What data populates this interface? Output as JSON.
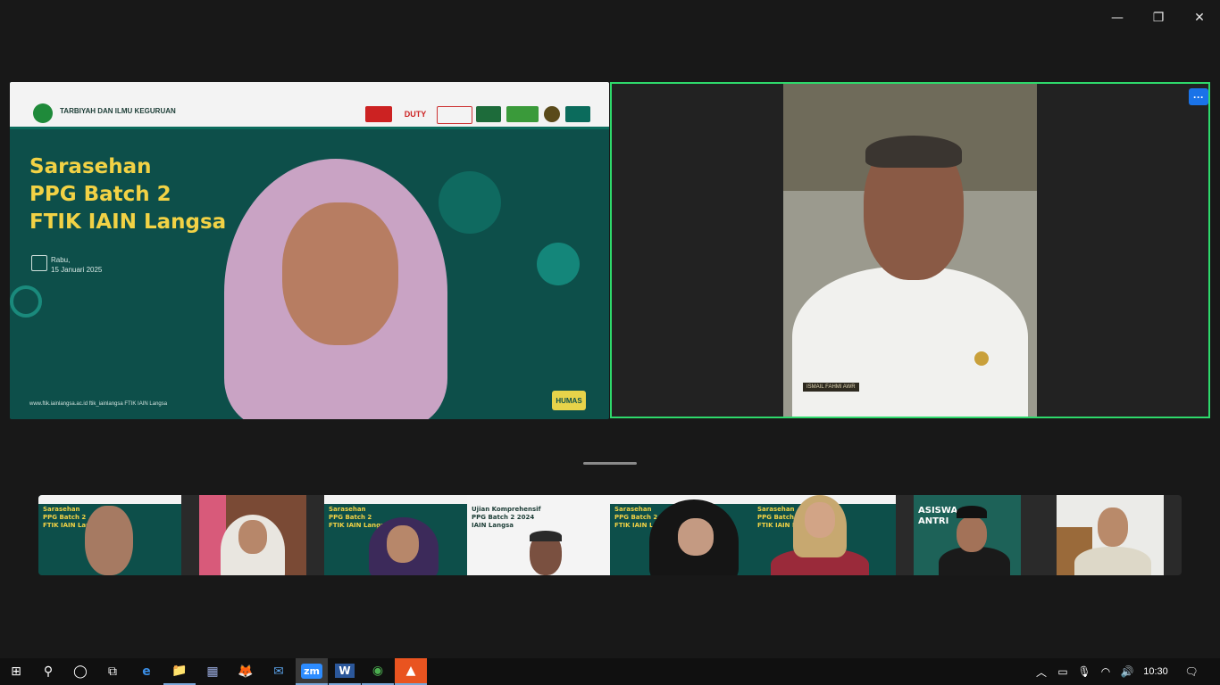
{
  "window": {
    "minimize_glyph": "—",
    "maximize_glyph": "❐",
    "close_glyph": "✕"
  },
  "main_left": {
    "institution": "TARBIYAH DAN ILMU KEGURUAN",
    "title_lines": [
      "Sarasehan",
      "PPG Batch 2",
      "FTIK IAIN Langsa"
    ],
    "date_day": "Rabu,",
    "date": "15 Januari 2025",
    "footer": "www.ftik.iainlangsa.ac.id      ftik_iainlangsa      FTIK IAIN Langsa",
    "sponsors": [
      "DUTY"
    ],
    "humas": "HUMAS"
  },
  "main_right": {
    "more_glyph": "···",
    "nametag": "ISMAIL FAHMI AWR"
  },
  "thumbnails": [
    {
      "label": "Sarasehan\nPPG Batch 2\nFTIK IAIN Langsa"
    },
    {
      "label": ""
    },
    {
      "label": "Sarasehan\nPPG Batch 2\nFTIK IAIN Langsa"
    },
    {
      "label": "Ujian Komprehensif\nPPG Batch 2 2024\nIAIN Langsa"
    },
    {
      "label": "Sarasehan\nPPG Batch 2\nFTIK IAIN Langsa"
    },
    {
      "label": "Sarasehan\nPPG Batch 2\nFTIK IAIN Langsa"
    },
    {
      "label": "ASISWA\nANTRI"
    },
    {
      "label": ""
    }
  ],
  "taskbar": {
    "start": "⊞",
    "search": "⚲",
    "cortana": "◯",
    "taskview": "⧉",
    "apps": [
      "e",
      "📁",
      "▦",
      "🦊",
      "✉",
      "zm",
      "W",
      "◉",
      "▲"
    ],
    "tray_chevron": "︿",
    "clock": "10:30",
    "notification": "🗨"
  }
}
